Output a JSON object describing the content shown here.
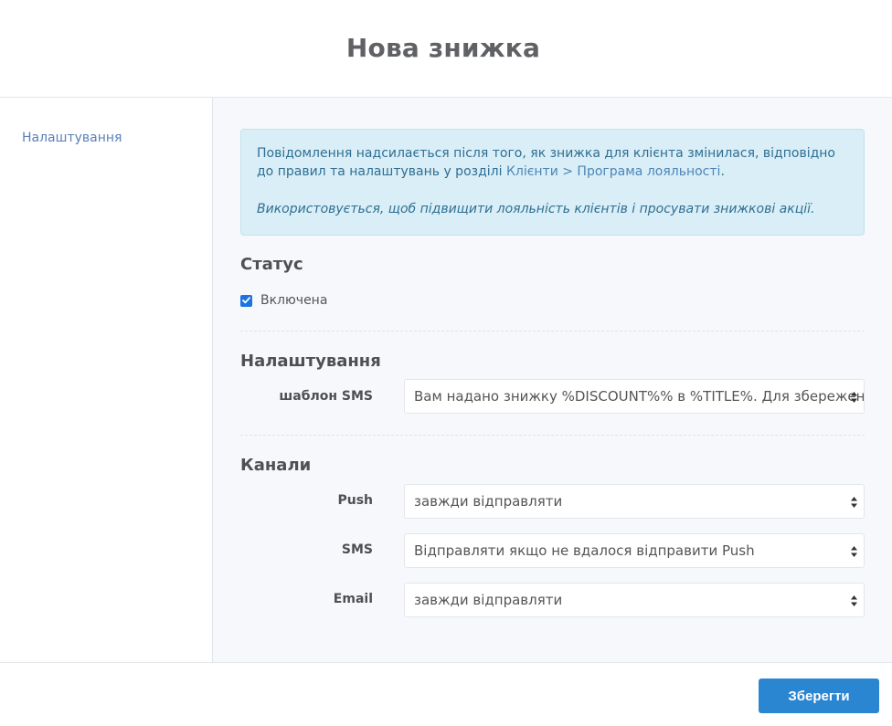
{
  "header": {
    "title": "Нова знижка"
  },
  "sidebar": {
    "items": [
      {
        "label": "Налаштування"
      }
    ]
  },
  "info": {
    "text1": "Повідомлення надсилається після того, як знижка для клієнта змінилася, відповідно до правил та налаштувань у розділі",
    "link": "Клієнти > Програма лояльності",
    "period": ".",
    "text2": "Використовується, щоб підвищити лояльність клієнтів і просувати знижкові акції."
  },
  "status": {
    "title": "Статус",
    "checkbox_label": "Включена",
    "checked": true
  },
  "settings": {
    "title": "Налаштування",
    "sms_template_label": "шаблон SMS",
    "sms_template_value": "Вам надано знижку %DISCOUNT%% в %TITLE%. Для збереження"
  },
  "channels": {
    "title": "Канали",
    "push_label": "Push",
    "push_value": "завжди відправляти",
    "sms_label": "SMS",
    "sms_value": "Відправляти якщо не вдалося відправити Push",
    "email_label": "Email",
    "email_value": "завжди відправляти"
  },
  "footer": {
    "save_label": "Зберегти"
  },
  "colors": {
    "accent": "#2b86d1",
    "checkbox": "#1b74e4",
    "info_bg": "#d9eef6",
    "info_text": "#2f6f93",
    "link": "#5b7fb8"
  },
  "icons": {
    "checkbox": "checkmark-icon",
    "select_arrow": "sort-arrows-icon"
  }
}
